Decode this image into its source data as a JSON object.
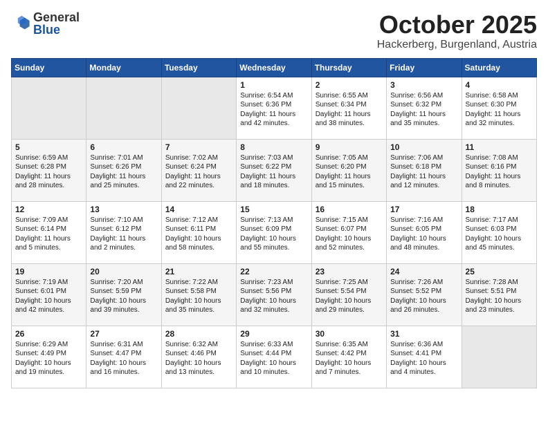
{
  "header": {
    "logo_general": "General",
    "logo_blue": "Blue",
    "month": "October 2025",
    "location": "Hackerberg, Burgenland, Austria"
  },
  "weekdays": [
    "Sunday",
    "Monday",
    "Tuesday",
    "Wednesday",
    "Thursday",
    "Friday",
    "Saturday"
  ],
  "weeks": [
    [
      {
        "day": "",
        "info": ""
      },
      {
        "day": "",
        "info": ""
      },
      {
        "day": "",
        "info": ""
      },
      {
        "day": "1",
        "info": "Sunrise: 6:54 AM\nSunset: 6:36 PM\nDaylight: 11 hours and 42 minutes."
      },
      {
        "day": "2",
        "info": "Sunrise: 6:55 AM\nSunset: 6:34 PM\nDaylight: 11 hours and 38 minutes."
      },
      {
        "day": "3",
        "info": "Sunrise: 6:56 AM\nSunset: 6:32 PM\nDaylight: 11 hours and 35 minutes."
      },
      {
        "day": "4",
        "info": "Sunrise: 6:58 AM\nSunset: 6:30 PM\nDaylight: 11 hours and 32 minutes."
      }
    ],
    [
      {
        "day": "5",
        "info": "Sunrise: 6:59 AM\nSunset: 6:28 PM\nDaylight: 11 hours and 28 minutes."
      },
      {
        "day": "6",
        "info": "Sunrise: 7:01 AM\nSunset: 6:26 PM\nDaylight: 11 hours and 25 minutes."
      },
      {
        "day": "7",
        "info": "Sunrise: 7:02 AM\nSunset: 6:24 PM\nDaylight: 11 hours and 22 minutes."
      },
      {
        "day": "8",
        "info": "Sunrise: 7:03 AM\nSunset: 6:22 PM\nDaylight: 11 hours and 18 minutes."
      },
      {
        "day": "9",
        "info": "Sunrise: 7:05 AM\nSunset: 6:20 PM\nDaylight: 11 hours and 15 minutes."
      },
      {
        "day": "10",
        "info": "Sunrise: 7:06 AM\nSunset: 6:18 PM\nDaylight: 11 hours and 12 minutes."
      },
      {
        "day": "11",
        "info": "Sunrise: 7:08 AM\nSunset: 6:16 PM\nDaylight: 11 hours and 8 minutes."
      }
    ],
    [
      {
        "day": "12",
        "info": "Sunrise: 7:09 AM\nSunset: 6:14 PM\nDaylight: 11 hours and 5 minutes."
      },
      {
        "day": "13",
        "info": "Sunrise: 7:10 AM\nSunset: 6:12 PM\nDaylight: 11 hours and 2 minutes."
      },
      {
        "day": "14",
        "info": "Sunrise: 7:12 AM\nSunset: 6:11 PM\nDaylight: 10 hours and 58 minutes."
      },
      {
        "day": "15",
        "info": "Sunrise: 7:13 AM\nSunset: 6:09 PM\nDaylight: 10 hours and 55 minutes."
      },
      {
        "day": "16",
        "info": "Sunrise: 7:15 AM\nSunset: 6:07 PM\nDaylight: 10 hours and 52 minutes."
      },
      {
        "day": "17",
        "info": "Sunrise: 7:16 AM\nSunset: 6:05 PM\nDaylight: 10 hours and 48 minutes."
      },
      {
        "day": "18",
        "info": "Sunrise: 7:17 AM\nSunset: 6:03 PM\nDaylight: 10 hours and 45 minutes."
      }
    ],
    [
      {
        "day": "19",
        "info": "Sunrise: 7:19 AM\nSunset: 6:01 PM\nDaylight: 10 hours and 42 minutes."
      },
      {
        "day": "20",
        "info": "Sunrise: 7:20 AM\nSunset: 5:59 PM\nDaylight: 10 hours and 39 minutes."
      },
      {
        "day": "21",
        "info": "Sunrise: 7:22 AM\nSunset: 5:58 PM\nDaylight: 10 hours and 35 minutes."
      },
      {
        "day": "22",
        "info": "Sunrise: 7:23 AM\nSunset: 5:56 PM\nDaylight: 10 hours and 32 minutes."
      },
      {
        "day": "23",
        "info": "Sunrise: 7:25 AM\nSunset: 5:54 PM\nDaylight: 10 hours and 29 minutes."
      },
      {
        "day": "24",
        "info": "Sunrise: 7:26 AM\nSunset: 5:52 PM\nDaylight: 10 hours and 26 minutes."
      },
      {
        "day": "25",
        "info": "Sunrise: 7:28 AM\nSunset: 5:51 PM\nDaylight: 10 hours and 23 minutes."
      }
    ],
    [
      {
        "day": "26",
        "info": "Sunrise: 6:29 AM\nSunset: 4:49 PM\nDaylight: 10 hours and 19 minutes."
      },
      {
        "day": "27",
        "info": "Sunrise: 6:31 AM\nSunset: 4:47 PM\nDaylight: 10 hours and 16 minutes."
      },
      {
        "day": "28",
        "info": "Sunrise: 6:32 AM\nSunset: 4:46 PM\nDaylight: 10 hours and 13 minutes."
      },
      {
        "day": "29",
        "info": "Sunrise: 6:33 AM\nSunset: 4:44 PM\nDaylight: 10 hours and 10 minutes."
      },
      {
        "day": "30",
        "info": "Sunrise: 6:35 AM\nSunset: 4:42 PM\nDaylight: 10 hours and 7 minutes."
      },
      {
        "day": "31",
        "info": "Sunrise: 6:36 AM\nSunset: 4:41 PM\nDaylight: 10 hours and 4 minutes."
      },
      {
        "day": "",
        "info": ""
      }
    ]
  ]
}
